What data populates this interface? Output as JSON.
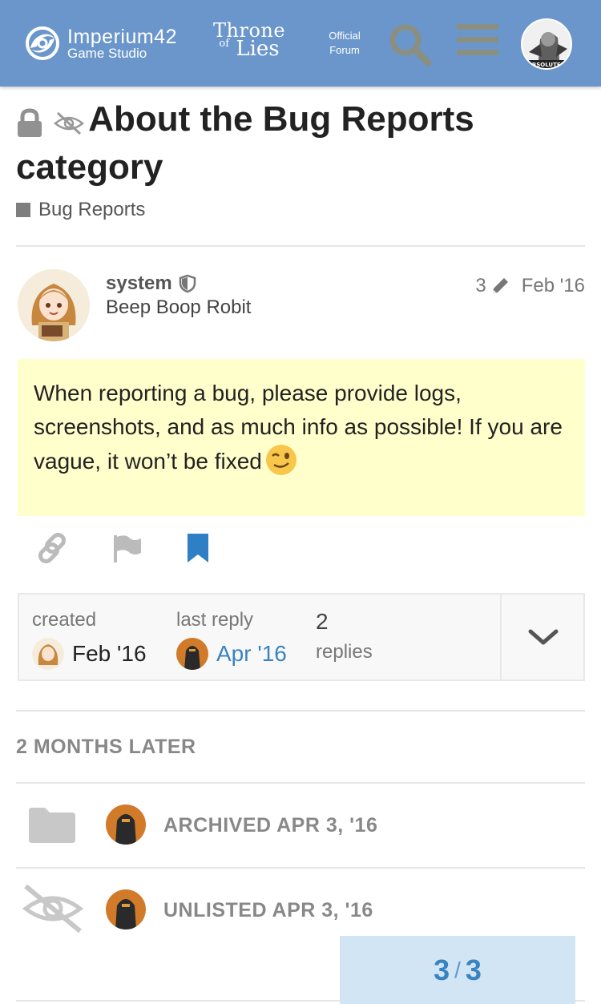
{
  "header": {
    "brand_name": "Imperium42",
    "brand_sub": "Game Studio",
    "game_logo_line1": "Throne",
    "game_logo_of": "of",
    "game_logo_line2": "Lies",
    "official_line1": "Official",
    "official_line2": "Forum",
    "search_icon": "search-icon",
    "menu_icon": "hamburger-menu-icon",
    "avatar_text": "BSOLUTEL",
    "colors": {
      "bar": "#6a96cb",
      "icon": "#8a8f82"
    }
  },
  "topic": {
    "title": "About the Bug Reports category",
    "status_icons": [
      "lock-icon",
      "eye-slash-icon"
    ],
    "category": "Bug Reports",
    "category_color": "#7e7e7e"
  },
  "post": {
    "username": "system",
    "user_title": "Beep Boop Robit",
    "edit_count": "3",
    "date": "Feb '16",
    "body": "When reporting a bug, please provide logs, screenshots, and as much info as possible! If you are vague, it won’t be fixed",
    "emoji": "wink-emoji",
    "actions": [
      "link-icon",
      "flag-icon",
      "bookmark-icon"
    ],
    "highlight_color": "#ffffcc"
  },
  "topic_map": {
    "created_label": "created",
    "created_date": "Feb '16",
    "last_reply_label": "last reply",
    "last_reply_date": "Apr '16",
    "replies_count": "2",
    "replies_label": "replies"
  },
  "timeline": {
    "gap": "2 MONTHS LATER",
    "actions": [
      {
        "icon": "folder-icon",
        "text": "ARCHIVED APR 3, '16"
      },
      {
        "icon": "eye-slash-icon",
        "text": "UNLISTED APR 3, '16"
      }
    ]
  },
  "progress": {
    "current": "3",
    "separator": "/",
    "total": "3"
  }
}
